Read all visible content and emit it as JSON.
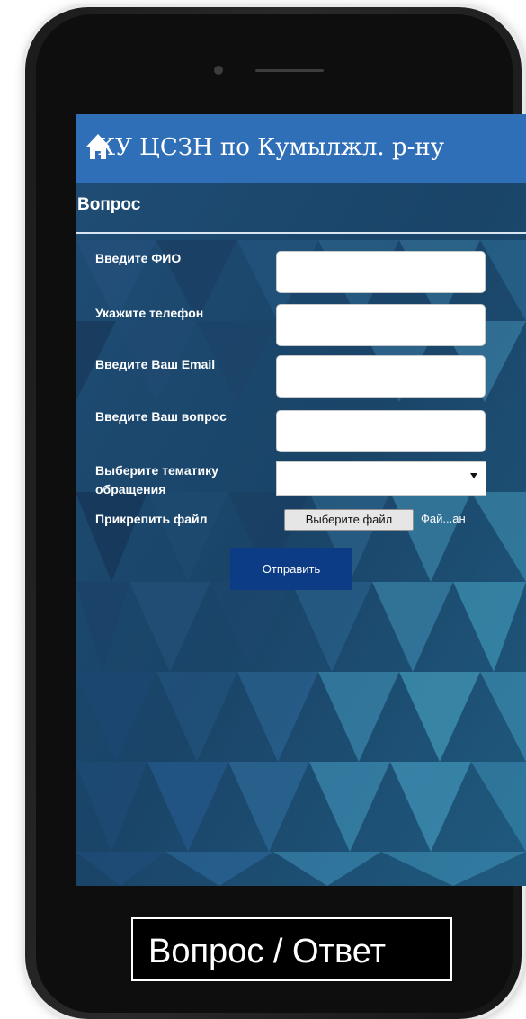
{
  "header": {
    "title": "КУ ЦСЗН по Кумылжл. р-ну",
    "home_icon": "home-icon"
  },
  "section": {
    "title": "Вопрос"
  },
  "form": {
    "fio_label": "Введите ФИО",
    "fio_value": "",
    "phone_label": "Укажите телефон",
    "phone_value": "",
    "email_label": "Введите Ваш Email",
    "email_value": "",
    "question_label": "Введите Ваш вопрос",
    "question_value": "",
    "topic_label": "Выберите тематику обращения",
    "topic_value": "",
    "attach_label": "Прикрепить файл",
    "file_button_label": "Выберите файл",
    "file_status": "Фай...ан",
    "submit_label": "Отправить"
  },
  "caption": {
    "text": "Вопрос / Ответ"
  },
  "colors": {
    "header_bg": "#2f6fb8",
    "submit_bg": "#0d3c86",
    "screen_bg": "#163a5c"
  }
}
